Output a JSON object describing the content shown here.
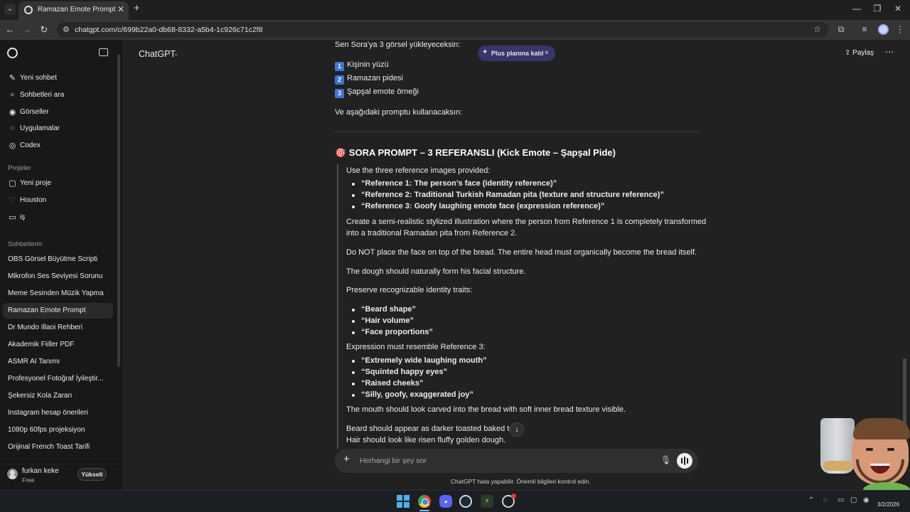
{
  "browser": {
    "tab_title": "Ramazan Emote Prompt",
    "tab_close": "✕",
    "new_tab": "+",
    "url": "chatgpt.com/c/699b22a0-db68-8332-a5b4-1c926c71c2f8",
    "window_controls": [
      "—",
      "❐",
      "✕"
    ]
  },
  "sidebar": {
    "top_items": [
      {
        "label": "Yeni sohbet",
        "icon": "edit-icon"
      },
      {
        "label": "Sohbetleri ara",
        "icon": "search-icon"
      },
      {
        "label": "Görseller",
        "icon": "images-icon"
      },
      {
        "label": "Uygulamalar",
        "icon": "apps-icon"
      },
      {
        "label": "Codex",
        "icon": "codex-icon"
      }
    ],
    "projects_heading": "Projeler",
    "projects": [
      {
        "label": "Yeni proje",
        "icon": "new-folder-icon"
      },
      {
        "label": "Houston",
        "icon": "heart-icon"
      },
      {
        "label": "iş",
        "icon": "folder-icon"
      }
    ],
    "chats_heading": "Sohbetlerin",
    "chats": [
      "OBS Görsel Büyütme Scripti",
      "Mikrofon Ses Seviyesi Sorunu",
      "Meme Sesinden Müzik Yapma",
      "Ramazan Emote Prompt",
      "Dr Mundo Illaoi Rehberi",
      "Akademik Fiiller PDF",
      "ASMR AI Tanımı",
      "Profesyonel Fotoğraf İyileştir...",
      "Şekersiz Kola Zararı",
      "Instagram hesap önerileri",
      "1080p 60fps projeksiyon",
      "Orijinal French Toast Tarifi"
    ],
    "active_chat": "Ramazan Emote Prompt",
    "user": {
      "name": "furkan keke",
      "plan": "Free",
      "upgrade": "Yükselt"
    }
  },
  "header": {
    "model": "ChatGPT",
    "plus_pill": "Plus planına katıl",
    "plus_close": "×",
    "share": "Paylaş",
    "more": "⋯"
  },
  "message": {
    "intro": "Sen Sora'ya 3 görsel yükleyeceksin:",
    "numbered": [
      {
        "n": "1",
        "text": "Kişinin yüzü"
      },
      {
        "n": "2",
        "text": "Ramazan pidesi"
      },
      {
        "n": "3",
        "text": "Şapşal emote örneği"
      }
    ],
    "use_prompt": "Ve aşağıdaki promptu kullanacaksın:",
    "heading": "🎯 SORA PROMPT – 3 REFERANSLI (Kick Emote – Şapşal Pide)",
    "use_refs": "Use the three reference images provided:",
    "refs": [
      "“Reference 1: The person’s face (identity reference)”",
      "“Reference 2: Traditional Turkish Ramadan pita (texture and structure reference)”",
      "“Reference 3: Goofy laughing emote face (expression reference)”"
    ],
    "create_1": "Create a semi-realistic stylized illustration where the person from Reference 1 is completely transformed",
    "create_2": "into a traditional Ramadan pita from Reference 2.",
    "do_not": "Do NOT place the face on top of the bread. The entire head must organically become the bread itself.",
    "dough": "The dough should naturally form his facial structure.",
    "preserve": "Preserve recognizable identity traits:",
    "traits": [
      "“Beard shape”",
      "“Hair volume”",
      "“Face proportions”"
    ],
    "expression": "Expression must resemble Reference 3:",
    "expr_items": [
      "“Extremely wide laughing mouth”",
      "“Squinted happy eyes”",
      "“Raised cheeks”",
      "“Silly, goofy, exaggerated joy”"
    ],
    "mouth": "The mouth should look carved into the bread with soft inner bread texture visible.",
    "beard": "Beard should appear as darker toasted baked tex",
    "hair": "Hair should look like risen fluffy golden dough."
  },
  "composer": {
    "placeholder": "Herhangi bir şey sor",
    "disclaimer": "ChatGPT hata yapabilir. Önemli bilgileri kontrol edin."
  },
  "taskbar": {
    "date": "3/2/2026"
  },
  "colors": {
    "background": "#212121",
    "sidebar": "#181818",
    "plus_pill": "#373669"
  }
}
